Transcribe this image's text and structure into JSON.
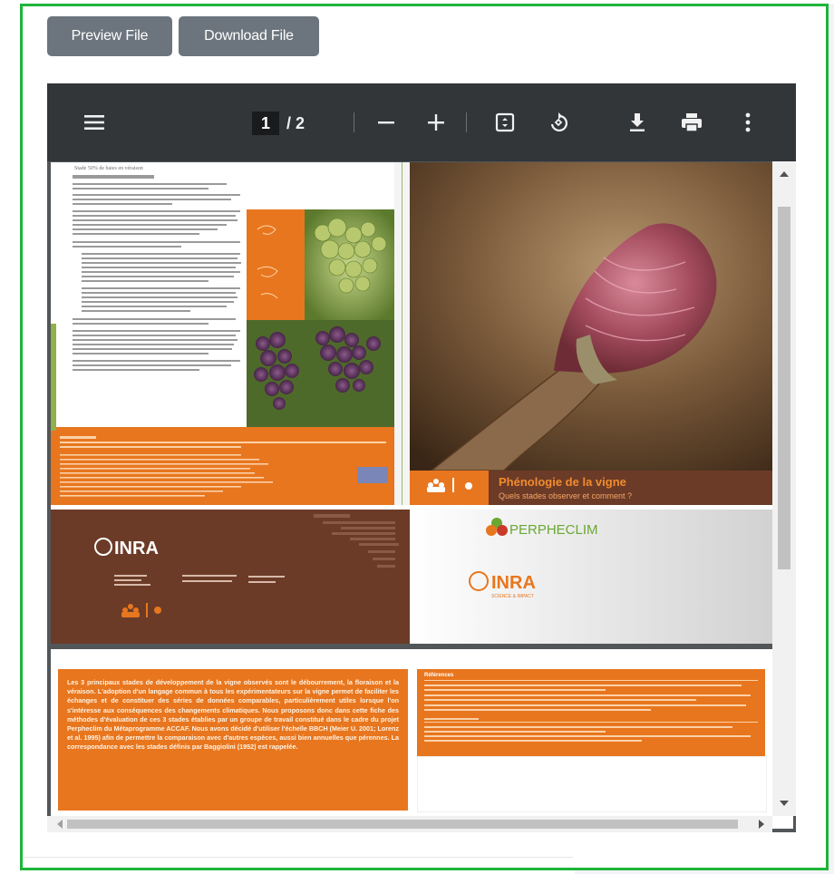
{
  "toolbar": {
    "preview_label": "Preview File",
    "download_label": "Download File"
  },
  "viewer": {
    "current_page": "1",
    "page_separator": "/ 2",
    "icons": {
      "menu": "hamburger-menu-icon",
      "zoom_out": "minus-icon",
      "zoom_in": "plus-icon",
      "fit": "fit-page-icon",
      "rotate": "rotate-icon",
      "download": "download-icon",
      "print": "print-icon",
      "more": "more-vertical-icon"
    }
  },
  "brochure": {
    "left_heading": "Stade 50% de baies en véraison",
    "left_intro": "La véraison marque le début du processus de maturation des raisins, qui se terminera à la vendange.",
    "title": "Phénologie de la vigne",
    "subtitle": "Quels stades observer et comment ?",
    "perpheclim": "PERPHECLIM",
    "inra": "INRA",
    "inra_tagline": "SCIENCE & IMPACT",
    "page2_text": "Les 3 principaux stades de développement de la vigne observés sont le débourrement, la floraison et la véraison. L'adoption d'un langage commun à tous les expérimentateurs sur la vigne permet de faciliter les échanges et de constituer des séries de données comparables, particulièrement utiles lorsque l'on s'intéresse aux conséquences des changements climatiques. Nous proposons donc dans cette fiche des méthodes d'évaluation de ces 3 stades établies par un groupe de travail constitué dans le cadre du projet Perpheclim du Métaprogramme ACCAF. Nous avons décidé d'utiliser l'échelle BBCH (Meier U. 2001; Lorenz et al. 1995) afin de permettre la comparaison avec d'autres espèces, aussi bien annuelles que pérennes. La correspondance avec les stades définis par Baggiolini (1952) est rappelée.",
    "refs_heading": "Références"
  },
  "colors": {
    "accent_border": "#1fb43a",
    "button_bg": "#6c757d",
    "pdf_toolbar": "#323639",
    "brochure_orange": "#e8761e",
    "brochure_brown": "#6b3b27"
  }
}
